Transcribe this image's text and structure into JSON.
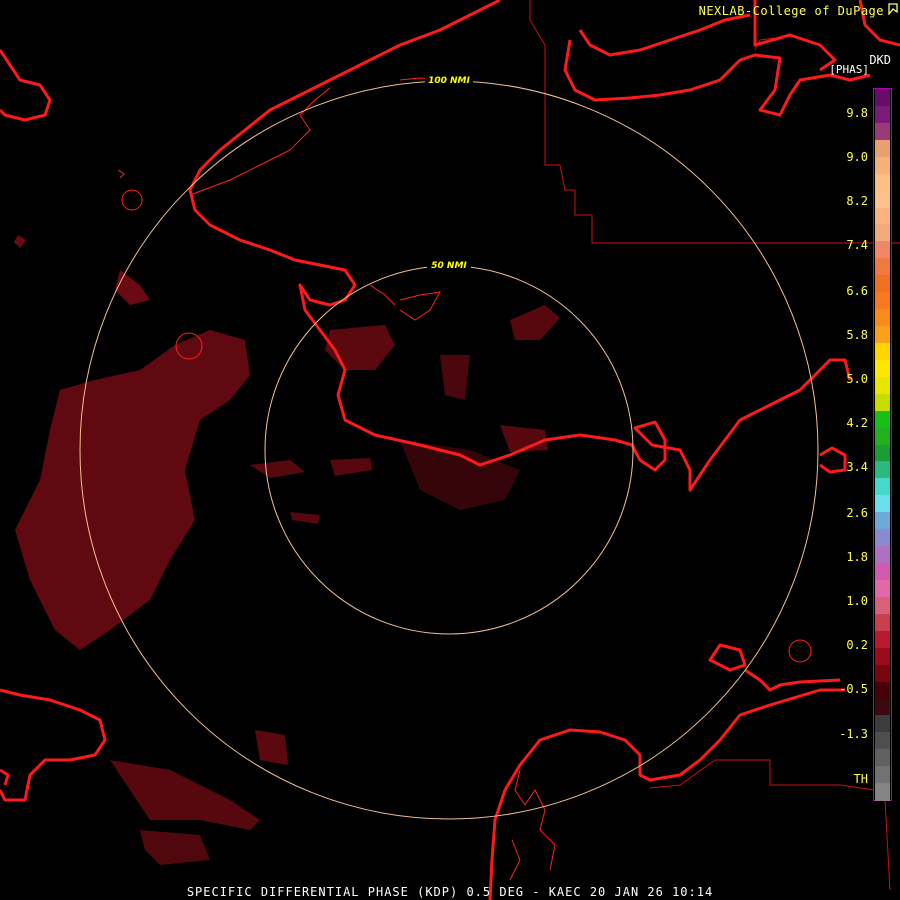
{
  "header": {
    "credit": "NEXLAB-College of DuPage"
  },
  "legend": {
    "product_code": "DKD",
    "unit": "[PHAS]",
    "ticks": [
      "9.8",
      "9.0",
      "8.2",
      "7.4",
      "6.6",
      "5.8",
      "5.0",
      "4.2",
      "3.4",
      "2.6",
      "1.8",
      "1.0",
      "0.2",
      "-0.5",
      "-1.3",
      "TH"
    ],
    "colors": [
      "#6a0a6a",
      "#7a1a7a",
      "#9a3a7a",
      "#e8a070",
      "#f6b07a",
      "#fbbf87",
      "#fcc08b",
      "#f7b482",
      "#f2aa7b",
      "#f08868",
      "#ee7a40",
      "#ef6f23",
      "#f57a20",
      "#f88c1a",
      "#fba01a",
      "#ffd400",
      "#ffe600",
      "#e6e600",
      "#c8dc00",
      "#16c016",
      "#20b020",
      "#1a9d35",
      "#2ab880",
      "#46d8c8",
      "#68e0ee",
      "#6ea8d8",
      "#8a8ad0",
      "#b070c0",
      "#d05ab0",
      "#e06aa8",
      "#d8607a",
      "#c84050",
      "#b81a30",
      "#9a0b1c",
      "#78050f",
      "#4a0008",
      "#3a0a10",
      "#3c3c3c",
      "#4e4e4e",
      "#606060",
      "#727272",
      "#848484"
    ]
  },
  "map": {
    "range_rings": [
      {
        "label": "50 NMI"
      },
      {
        "label": "100 NMI"
      }
    ]
  },
  "footer": {
    "caption": "SPECIFIC DIFFERENTIAL PHASE (KDP) 0.5 DEG - KAEC 20 JAN 26 10:14"
  }
}
